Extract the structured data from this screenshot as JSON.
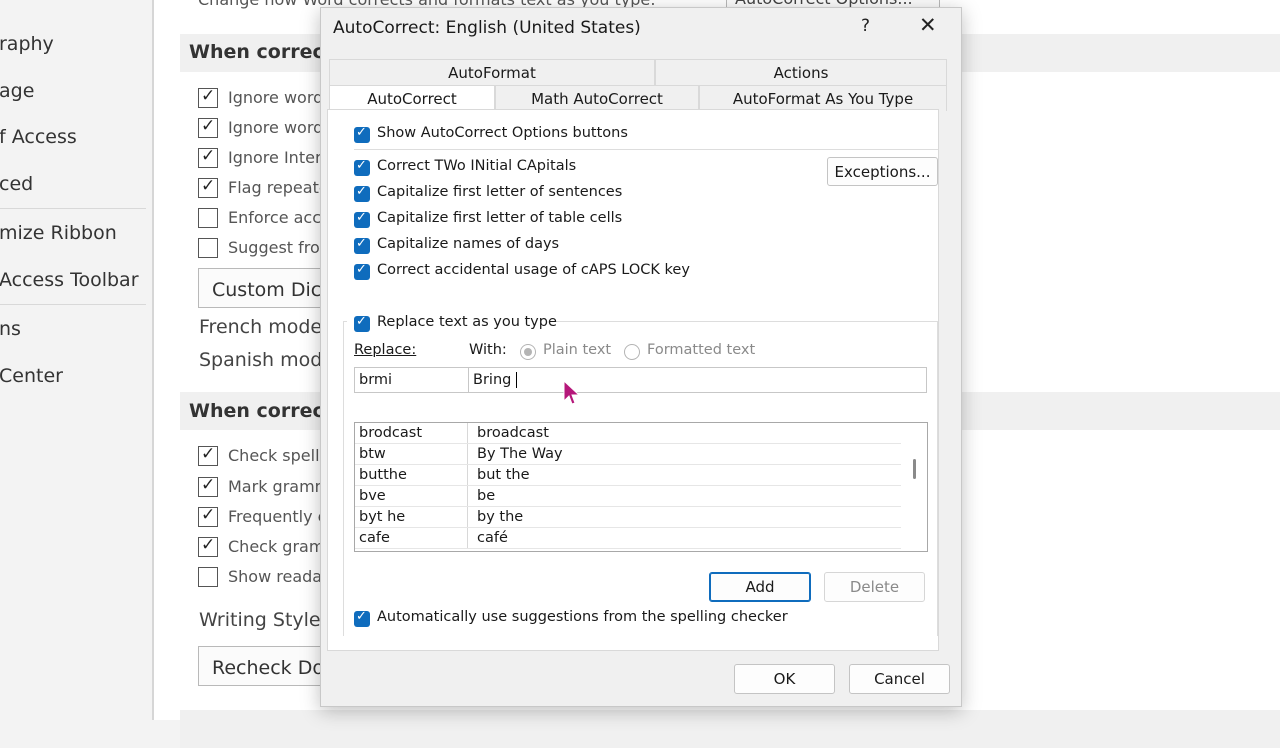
{
  "background": {
    "top_text": "Change how Word corrects and formats text as you type:",
    "top_button": "AutoCorrect Options...",
    "nav": [
      "raphy",
      "age",
      "f Access",
      "ced",
      "mize Ribbon",
      "Access Toolbar",
      "ns",
      "Center"
    ],
    "section1_title": "When correcti",
    "section1_rows": [
      {
        "label": "Ignore words",
        "checked": true
      },
      {
        "label": "Ignore words",
        "checked": true
      },
      {
        "label": "Ignore Intern",
        "checked": true
      },
      {
        "label": "Flag repeated",
        "checked": true
      },
      {
        "label": "Enforce acce",
        "checked": false
      },
      {
        "label": "Suggest from",
        "checked": false
      }
    ],
    "custom_dict_button": "Custom Dicti",
    "french_modes": "French modes",
    "spanish_modes": "Spanish mode",
    "section2_title": "When correcti",
    "section2_rows": [
      {
        "label": "Check spellin",
        "checked": true
      },
      {
        "label": "Mark gramm",
        "checked": true
      },
      {
        "label": "Frequently c",
        "checked": true
      },
      {
        "label": "Check gramr",
        "checked": true
      },
      {
        "label": "Show readab",
        "checked": false
      }
    ],
    "writing_style": "Writing Style:",
    "recheck_button": "Recheck Do"
  },
  "dialog": {
    "title": "AutoCorrect: English (United States)",
    "help": "?",
    "close": "✕",
    "tabs_row1": [
      "AutoFormat",
      "Actions"
    ],
    "tabs_row2": [
      "AutoCorrect",
      "Math AutoCorrect",
      "AutoFormat As You Type"
    ],
    "show_options": "Show AutoCorrect Options buttons",
    "options": [
      "Correct TWo INitial CApitals",
      "Capitalize first letter of sentences",
      "Capitalize first letter of table cells",
      "Capitalize names of days",
      "Correct accidental usage of cAPS LOCK key"
    ],
    "exceptions_button": "Exceptions...",
    "replace_text": "Replace text as you type",
    "replace_label": "Replace:",
    "with_label": "With:",
    "plain_text": "Plain text",
    "formatted_text": "Formatted text",
    "replace_value": "brmi",
    "with_value": "Bring ",
    "entries": [
      {
        "replace": "brodcast",
        "with": "broadcast"
      },
      {
        "replace": "btw",
        "with": "By The Way"
      },
      {
        "replace": "butthe",
        "with": "but the"
      },
      {
        "replace": "bve",
        "with": "be"
      },
      {
        "replace": "byt he",
        "with": "by the"
      },
      {
        "replace": "cafe",
        "with": "café"
      }
    ],
    "add_button": "Add",
    "delete_button": "Delete",
    "auto_suggest": "Automatically use suggestions from the spelling checker",
    "ok_button": "OK",
    "cancel_button": "Cancel",
    "accent_color": "#0f6cbd"
  }
}
